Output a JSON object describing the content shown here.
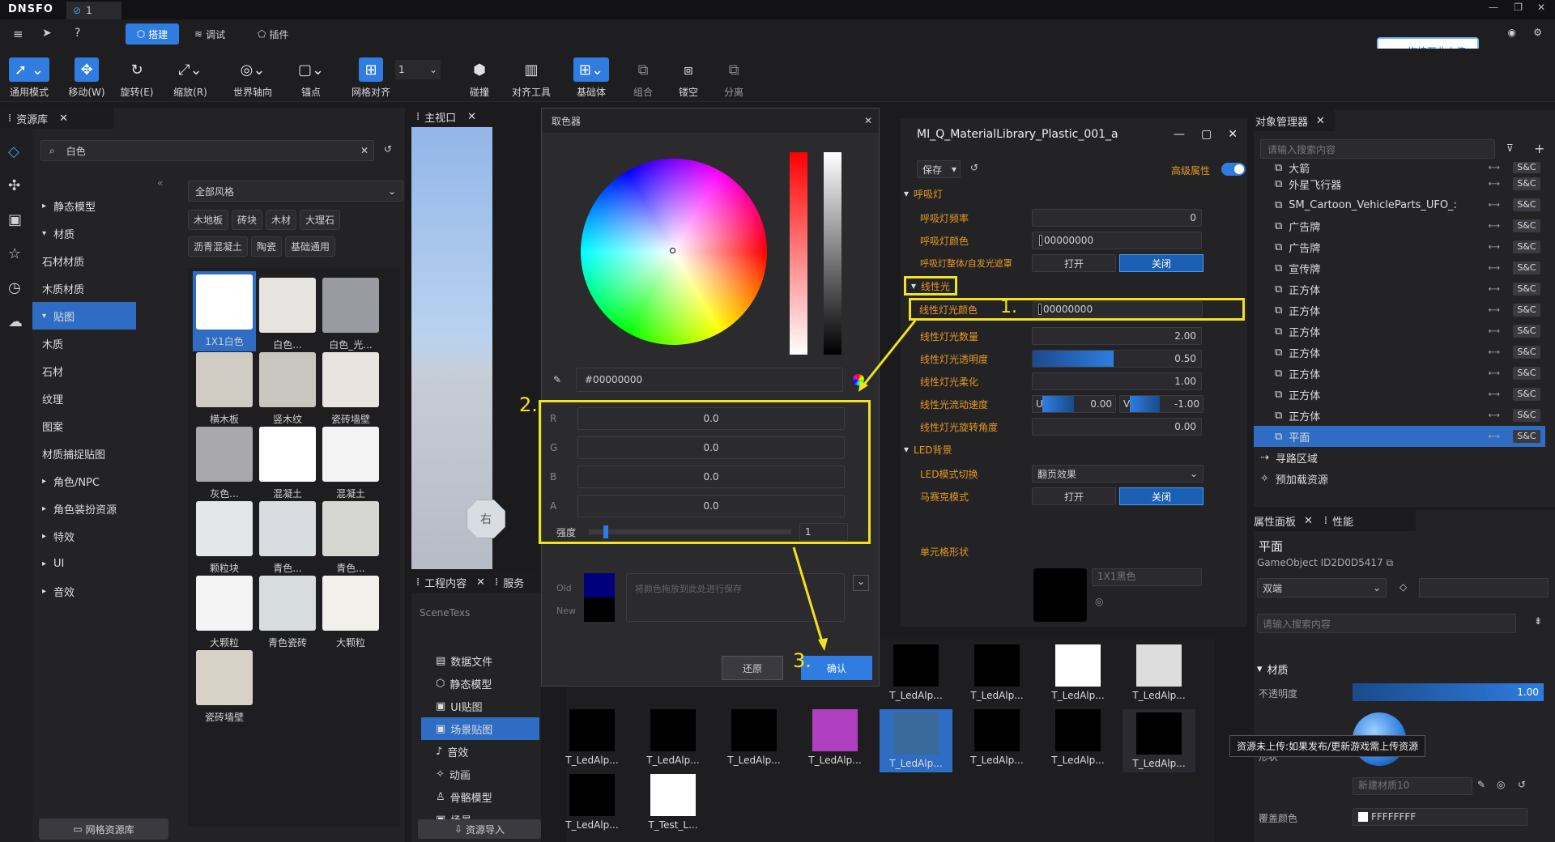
{
  "app": {
    "logo": "DNSFO",
    "tab_num": "1"
  },
  "menu": {
    "build": "搭建",
    "debug": "调试",
    "plugin": "插件",
    "upload": "拖拽至此上传"
  },
  "tools": [
    "通用模式",
    "移动(W)",
    "旋转(E)",
    "缩放(R)",
    "世界轴向",
    "锚点",
    "网格对齐",
    "1",
    "碰撞",
    "对齐工具",
    "基础体",
    "组合",
    "镂空",
    "分离"
  ],
  "assets_panel": {
    "title": "资源库",
    "search": "白色",
    "filter": "全部风格",
    "tags": [
      "木地板",
      "砖块",
      "木材",
      "大理石",
      "沥青混凝土",
      "陶瓷",
      "基础通用"
    ],
    "tree": [
      "静态模型",
      "材质",
      "石材材质",
      "木质材质",
      "贴图",
      "木质",
      "石材",
      "纹理",
      "图案",
      "材质捕捉贴图",
      "角色/NPC",
      "角色装扮资源",
      "特效",
      "UI",
      "音效"
    ],
    "thumbs": [
      "1X1白色",
      "白色...",
      "白色_光...",
      "横木板",
      "竖木纹",
      "瓷砖墙壁",
      "灰色...",
      "混凝土",
      "混凝土",
      "颗粒块",
      "青色...",
      "青色...",
      "大颗粒",
      "青色瓷砖",
      "大颗粒",
      "瓷砖墙壁"
    ],
    "footer": "网格资源库"
  },
  "viewport": {
    "title": "主视口",
    "cube_label": "右"
  },
  "project": {
    "title": "工程内容",
    "tab2": "服务",
    "path": "SceneTexs",
    "items": [
      "数据文件",
      "静态模型",
      "UI贴图",
      "场景贴图",
      "音效",
      "动画",
      "骨骼模型",
      "场景"
    ],
    "import": "资源导入"
  },
  "picker": {
    "title": "取色器",
    "hex": "#00000000",
    "R": "0.0",
    "G": "0.0",
    "B": "0.0",
    "A": "0.0",
    "strength_label": "强度",
    "strength": "1",
    "old": "Old",
    "new": "New",
    "drop_hint": "将颜色拖放到此处进行保存",
    "reset": "还原",
    "ok": "确认",
    "step2": "2.",
    "step3": "3."
  },
  "material": {
    "title": "MI_Q_MaterialLibrary_Plastic_001_a",
    "save": "保存",
    "advanced": "高级属性",
    "sec1": "呼吸灯",
    "r1": "呼吸灯频率",
    "v1": "0",
    "r2": "呼吸灯颜色",
    "v2": "00000000",
    "r3": "呼吸灯整体/自发光遮罩",
    "open": "打开",
    "close": "关闭",
    "sec2": "线性光",
    "r4": "线性灯光颜色",
    "v4": "00000000",
    "step1": "1.",
    "r5": "线性灯光数量",
    "v5": "2.00",
    "r6": "线性灯光透明度",
    "v6": "0.50",
    "r7": "线性灯光柔化",
    "v7": "1.00",
    "r8": "线性光流动速度",
    "u": "U",
    "v8u": "0.00",
    "vv": "V",
    "v8v": "-1.00",
    "r9": "线性灯光旋转角度",
    "v9": "0.00",
    "sec3": "LED背景",
    "r10": "LED模式切换",
    "v10": "翻页效果",
    "r11": "马赛克模式",
    "r12": "单元格形状",
    "v12": "1X1黑色"
  },
  "objects": {
    "title": "对象管理器",
    "search": "请输入搜索内容",
    "items": [
      "大箭",
      "外星飞行器",
      "SM_Cartoon_VehicleParts_UFO_:",
      "广告牌",
      "广告牌",
      "宣传牌",
      "正方体",
      "正方体",
      "正方体",
      "正方体",
      "正方体",
      "正方体",
      "正方体",
      "平面",
      "寻路区域",
      "预加载资源"
    ],
    "sc": "S&C"
  },
  "props": {
    "title": "属性面板",
    "perf": "性能",
    "name": "平面",
    "id": "GameObject ID2D0D5417",
    "mode": "双端",
    "search": "请输入搜索内容",
    "mat": "材质",
    "opacity": "不透明度",
    "opacity_v": "1.00",
    "newmat": "新建材质10",
    "cover": "覆盖颜色",
    "cover_v": "FFFFFFFF",
    "tooltip": "资源未上传:如果发布/更新游戏需上传资源",
    "shape_label": "形状"
  },
  "bottom_assets": [
    "T_LedAlp...",
    "T_LedAlp...",
    "T_LedAlp...",
    "T_LedAlp...",
    "T_LedAlp...",
    "T_LedAlp...",
    "T_LedAlp...",
    "T_LedAlp...",
    "T_LedAlp...",
    "T_LedAlp...",
    "T_LedAlp...",
    "T_LedAlp...",
    "T_LedAlp...",
    "T_Test_L..."
  ]
}
